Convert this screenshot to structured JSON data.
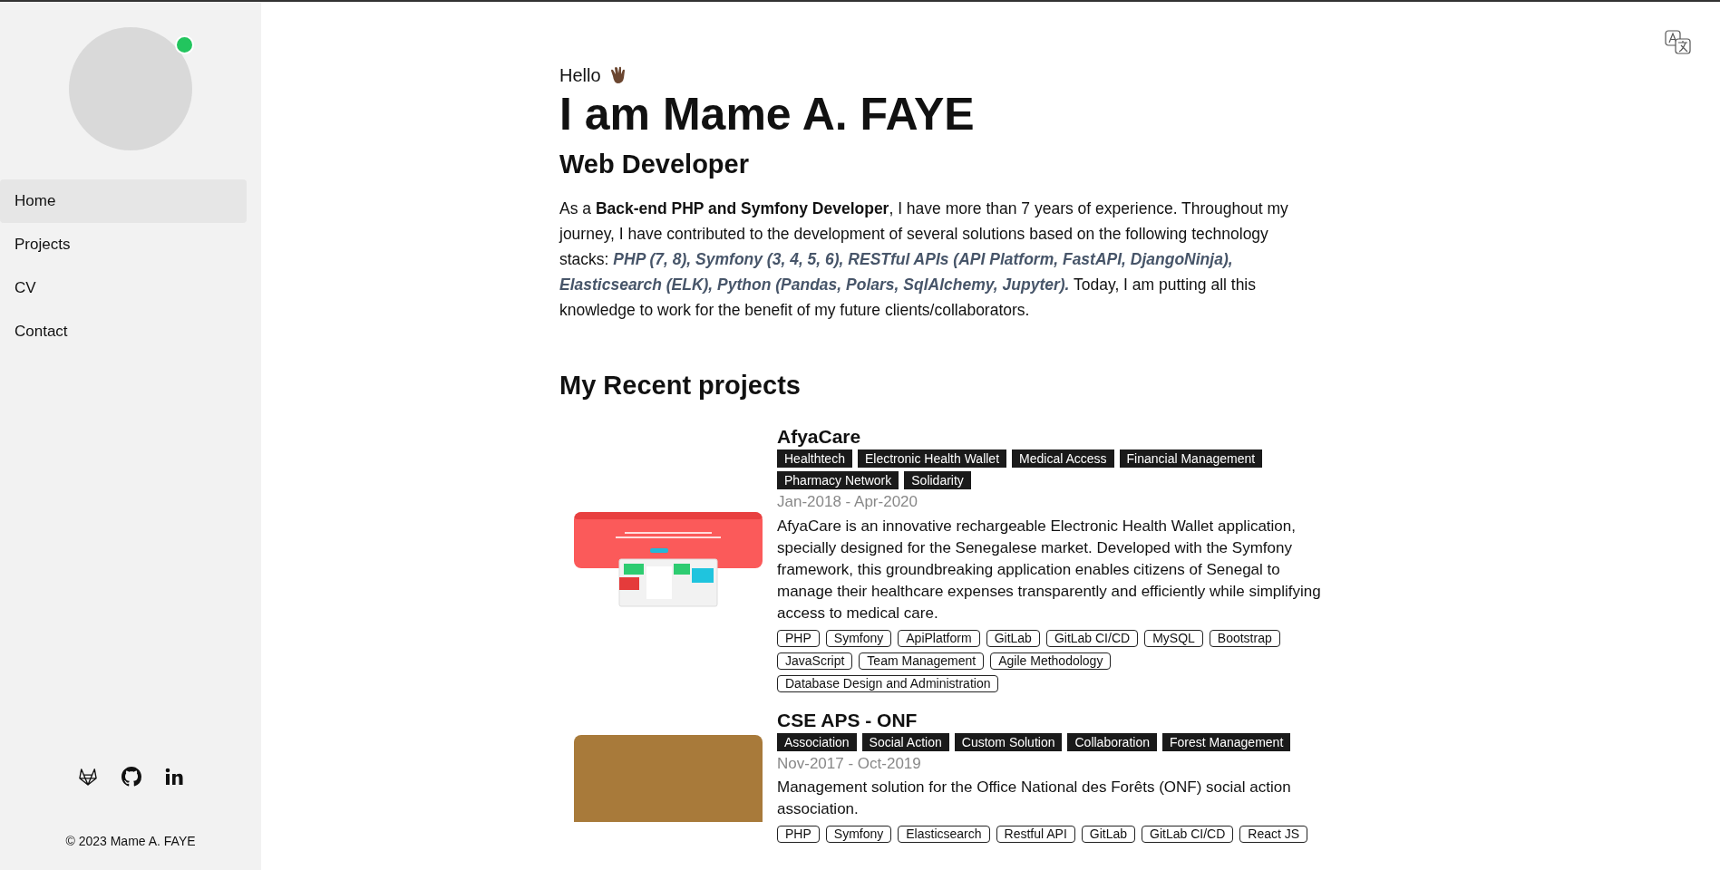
{
  "sidebar": {
    "avatar": {
      "color": "#22c55e"
    },
    "nav": [
      {
        "label": "Home",
        "selected": true
      },
      {
        "label": "Projects",
        "selected": false
      },
      {
        "label": "CV",
        "selected": false
      },
      {
        "label": "Contact",
        "selected": false
      }
    ],
    "social": [
      {
        "kind": "gitlab"
      },
      {
        "kind": "github"
      },
      {
        "kind": "linkedin"
      }
    ],
    "copyright": "© 2023 Mame A. FAYE"
  },
  "intro": {
    "greeting": "Hello",
    "name": "I am Mame A. FAYE",
    "role": "Web Developer",
    "bio": [
      {
        "kind": "plain",
        "text": "As a "
      },
      {
        "kind": "bold",
        "text": "Back-end PHP and Symfony Developer"
      },
      {
        "kind": "plain",
        "text": ", I have more than 7 years of experience. Throughout my journey, I have contributed to the development of several solutions based on the following technology stacks: "
      },
      {
        "kind": "tech",
        "text": "PHP (7, 8), Symfony (3, 4, 5, 6), RESTful APIs (API Platform, FastAPI, DjangoNinja), Elasticsearch (ELK), Python (Pandas, Polars, SqlAlchemy, Jupyter)."
      },
      {
        "kind": "plain",
        "text": " Today, I am putting all this knowledge to work for the benefit of my future clients/collaborators."
      }
    ]
  },
  "projects_title": "My Recent projects",
  "projects": [
    {
      "kind": "screenshot",
      "title": "AfyaCare",
      "categories": [
        "Healthtech",
        "Electronic Health Wallet",
        "Medical Access",
        "Financial Management",
        "Pharmacy Network",
        "Solidarity"
      ],
      "period": "Jan-2018 - Apr-2020",
      "description": "AfyaCare is an innovative rechargeable Electronic Health Wallet application, specially designed for the Senegalese market. Developed with the Symfony framework, this groundbreaking application enables citizens of Senegal to manage their healthcare expenses transparently and efficiently while simplifying access to medical care.",
      "skills": [
        "PHP",
        "Symfony",
        "ApiPlatform",
        "GitLab",
        "GitLab CI/CD",
        "MySQL",
        "Bootstrap",
        "JavaScript",
        "Team Management",
        "Agile Methodology",
        "Database Design and Administration"
      ]
    },
    {
      "kind": "photo",
      "title": "CSE APS - ONF",
      "categories": [
        "Association",
        "Social Action",
        "Custom Solution",
        "Collaboration",
        "Forest Management"
      ],
      "period": "Nov-2017 - Oct-2019",
      "description": "Management solution for the Office National des Forêts (ONF) social action association.",
      "skills": [
        "PHP",
        "Symfony",
        "Elasticsearch",
        "Restful API",
        "GitLab",
        "GitLab CI/CD",
        "React JS"
      ]
    }
  ]
}
